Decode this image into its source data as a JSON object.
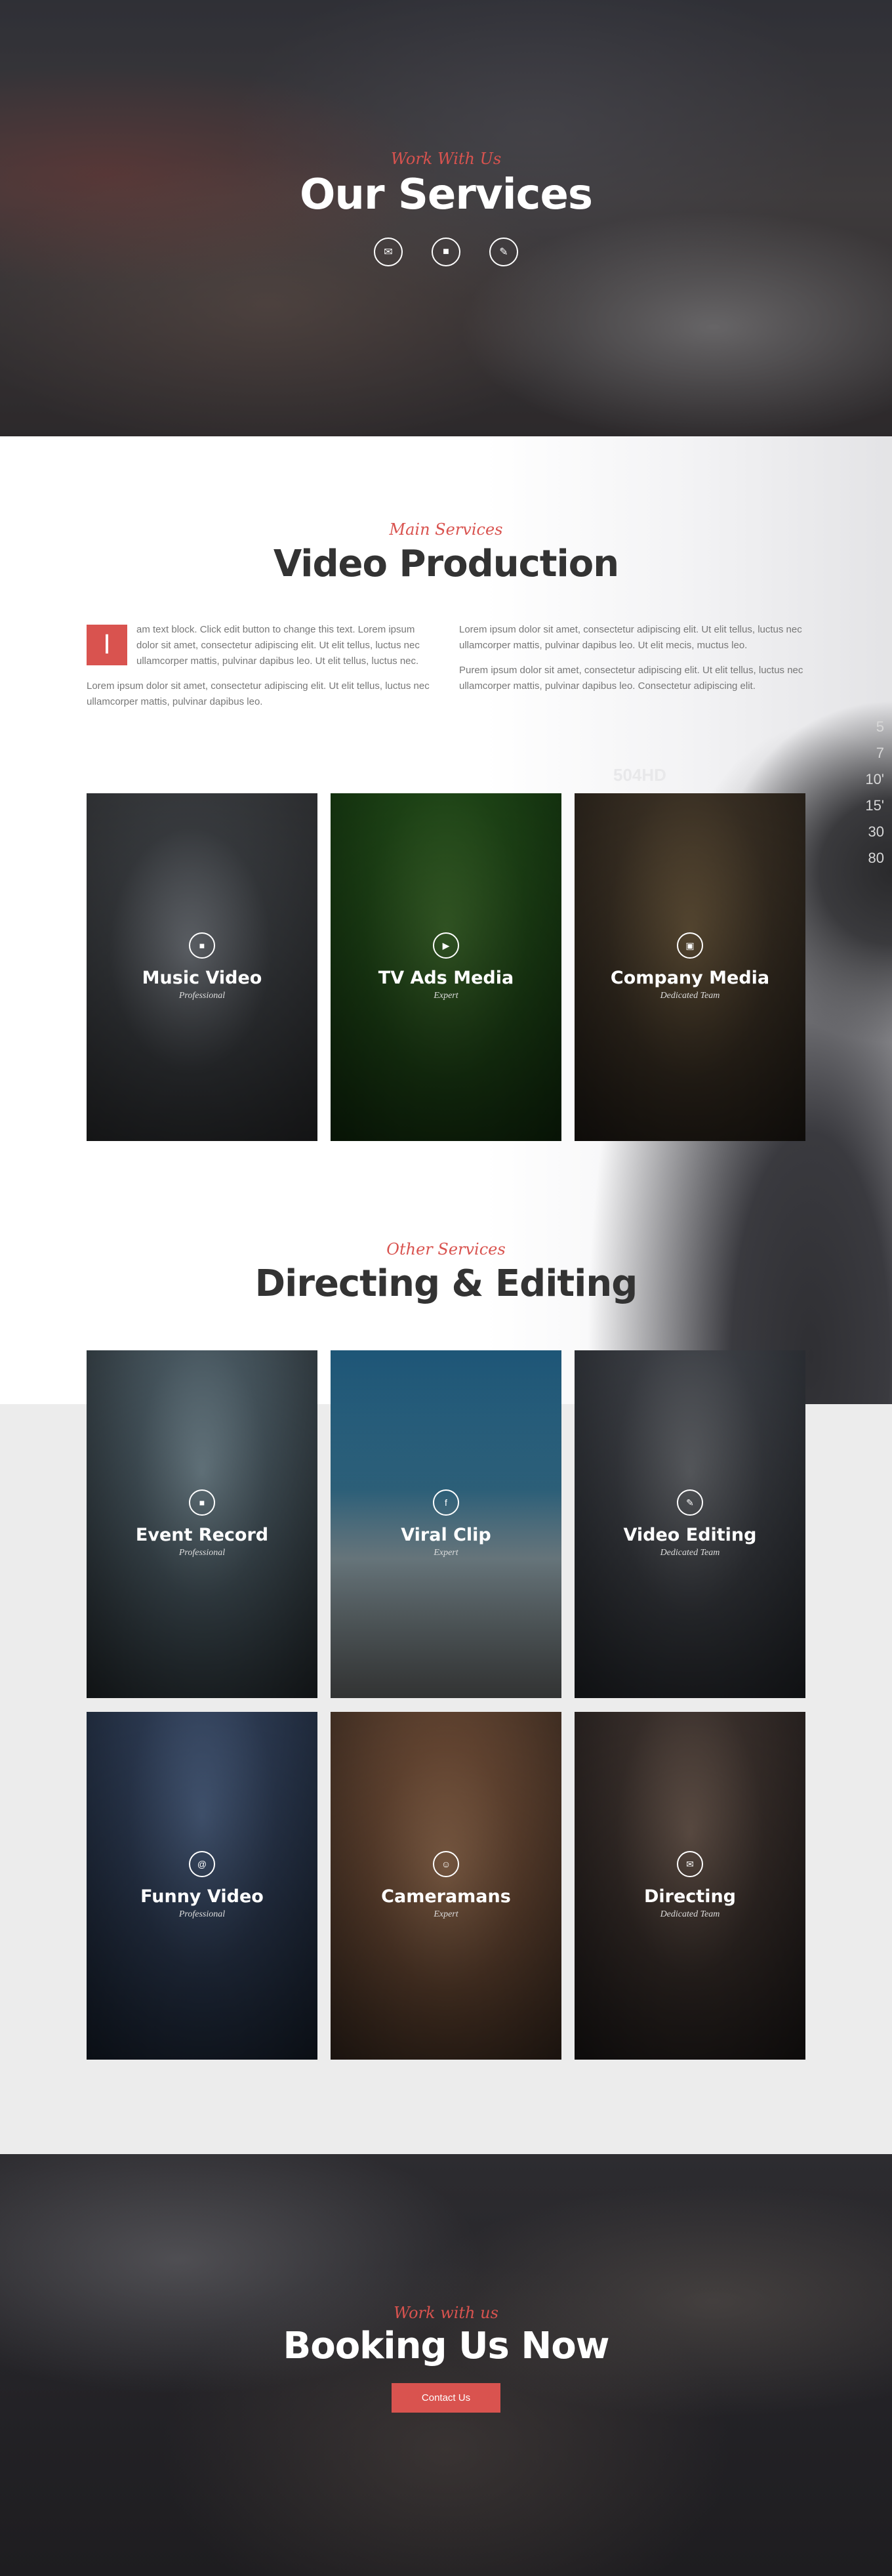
{
  "hero": {
    "kicker": "Work With Us",
    "title": "Our Services",
    "icons": [
      "megaphone-icon",
      "camera-icon",
      "pen-icon"
    ],
    "icon_glyphs": [
      "✉",
      "■",
      "✎"
    ]
  },
  "main_services": {
    "kicker": "Main Services",
    "title": "Video Production",
    "dropcap": "I",
    "left_p1": "am text block. Click edit button to change this text. Lorem ipsum dolor sit amet, consectetur adipiscing elit. Ut elit tellus, luctus nec ullamcorper mattis, pulvinar dapibus leo. Ut elit tellus, luctus nec.",
    "left_p2": "Lorem ipsum dolor sit amet, consectetur adipiscing elit. Ut elit tellus, luctus nec ullamcorper mattis, pulvinar dapibus leo.",
    "right_p1": "Lorem ipsum dolor sit amet, consectetur adipiscing elit. Ut elit tellus, luctus nec ullamcorper mattis, pulvinar dapibus leo. Ut elit mecis, muctus leo.",
    "right_p2": "Purem ipsum dolor sit amet, consectetur adipiscing elit. Ut elit tellus, luctus nec ullamcorper mattis, pulvinar dapibus leo. Consectetur adipiscing elit.",
    "deco_label": "504HD",
    "deco_ticks": [
      "5",
      "7",
      "10'",
      "15'",
      "30",
      "80"
    ]
  },
  "production_cards": [
    {
      "title": "Music Video",
      "subtitle": "Professional",
      "icon": "video-icon",
      "glyph": "■"
    },
    {
      "title": "TV Ads Media",
      "subtitle": "Expert",
      "icon": "play-icon",
      "glyph": "▶"
    },
    {
      "title": "Company Media",
      "subtitle": "Dedicated Team",
      "icon": "film-icon",
      "glyph": "▣"
    }
  ],
  "other_services": {
    "kicker": "Other Services",
    "title": "Directing & Editing"
  },
  "directing_cards": [
    {
      "title": "Event Record",
      "subtitle": "Professional",
      "icon": "video-icon",
      "glyph": "■"
    },
    {
      "title": "Viral Clip",
      "subtitle": "Expert",
      "icon": "facebook-icon",
      "glyph": "f"
    },
    {
      "title": "Video Editing",
      "subtitle": "Dedicated Team",
      "icon": "pen-icon",
      "glyph": "✎"
    },
    {
      "title": "Funny Video",
      "subtitle": "Professional",
      "icon": "at-icon",
      "glyph": "@"
    },
    {
      "title": "Cameramans",
      "subtitle": "Expert",
      "icon": "user-icon",
      "glyph": "☺"
    },
    {
      "title": "Directing",
      "subtitle": "Dedicated Team",
      "icon": "megaphone-icon",
      "glyph": "✉"
    }
  ],
  "booking": {
    "kicker": "Work with us",
    "title": "Booking Us Now",
    "button": "Contact Us"
  },
  "colors": {
    "accent": "#d9534f",
    "heading": "#333333",
    "body_text": "#777777"
  }
}
